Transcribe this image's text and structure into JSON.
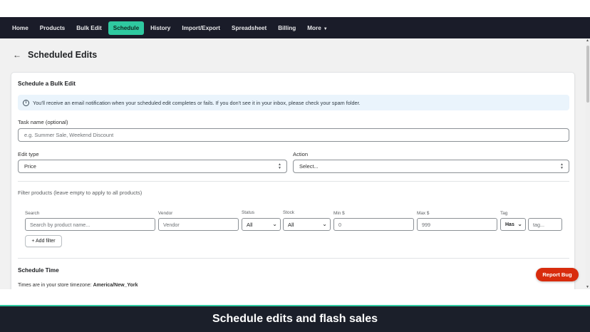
{
  "nav": {
    "items": [
      {
        "label": "Home"
      },
      {
        "label": "Products"
      },
      {
        "label": "Bulk Edit"
      },
      {
        "label": "Schedule",
        "active": true
      },
      {
        "label": "History"
      },
      {
        "label": "Import/Export"
      },
      {
        "label": "Spreadsheet"
      },
      {
        "label": "Billing"
      },
      {
        "label": "More"
      }
    ],
    "active_color": "#2fc9a0"
  },
  "page": {
    "title": "Scheduled Edits"
  },
  "card": {
    "title": "Schedule a Bulk Edit",
    "banner": "You'll receive an email notification when your scheduled edit completes or fails. If you don't see it in your inbox, please check your spam folder.",
    "task_name": {
      "label": "Task name (optional)",
      "placeholder": "e.g. Summer Sale, Weekend Discount"
    },
    "edit_type": {
      "label": "Edit type",
      "value": "Price"
    },
    "action": {
      "label": "Action",
      "value": "Select..."
    },
    "filter_heading": "Filter products (leave empty to apply to all products)",
    "filters": {
      "search": {
        "label": "Search",
        "placeholder": "Search by product name..."
      },
      "vendor": {
        "label": "Vendor",
        "placeholder": "Vendor"
      },
      "status": {
        "label": "Status",
        "value": "All"
      },
      "stock": {
        "label": "Stock",
        "value": "All"
      },
      "min_price": {
        "label": "Min $",
        "placeholder": "0"
      },
      "max_price": {
        "label": "Max $",
        "placeholder": "999"
      },
      "tag": {
        "label": "Tag",
        "mode": "Has",
        "placeholder": "tag..."
      }
    },
    "add_filter_label": "+ Add filter",
    "schedule_time": {
      "title": "Schedule Time",
      "timezone_prefix": "Times are in your store timezone:",
      "timezone": "America/New_York"
    }
  },
  "report_bug_label": "Report Bug",
  "report_bug_color": "#d82c0d",
  "caption": "Schedule edits and flash sales"
}
